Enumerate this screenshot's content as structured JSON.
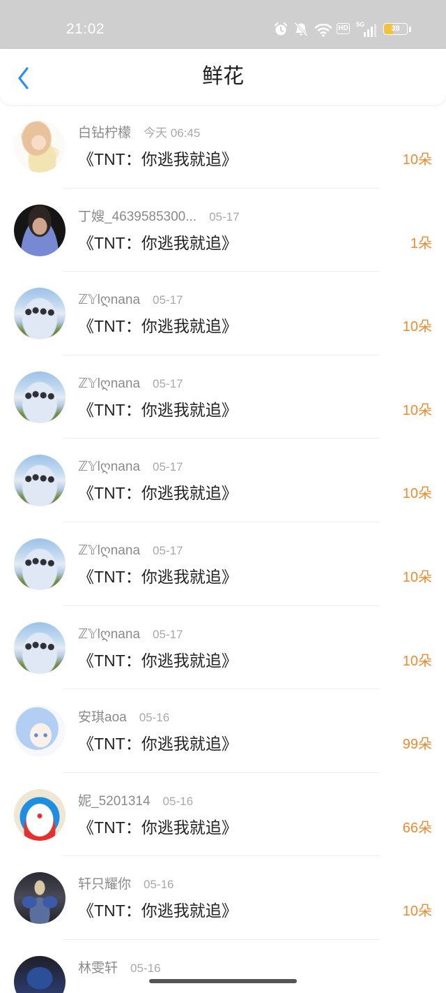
{
  "status_bar": {
    "time": "21:02",
    "hd_badge": "HD",
    "network_type": "5G",
    "battery_level": "39",
    "icons": [
      "alarm-icon",
      "bell-off-icon",
      "wifi-icon",
      "signal-icon",
      "battery-icon"
    ]
  },
  "header": {
    "title": "鲜花",
    "back_icon": "chevron-left-icon"
  },
  "colors": {
    "accent": "#2b8ff0",
    "flower_count": "#f08a2d",
    "status_bar_background": "#cfcfcf",
    "primary_text": "#222222",
    "secondary_text": "#8a8a8a"
  },
  "records": [
    {
      "name": "白钻柠檬",
      "time": "今天 06:45",
      "title": "《TNT：你逃我就追》",
      "count": "10朵"
    },
    {
      "name": "丁嫂_4639585300...",
      "time": "05-17",
      "title": "《TNT：你逃我就追》",
      "count": "1朵"
    },
    {
      "name": "ℤ𝕐lღnana",
      "time": "05-17",
      "title": "《TNT：你逃我就追》",
      "count": "10朵"
    },
    {
      "name": "ℤ𝕐lღnana",
      "time": "05-17",
      "title": "《TNT：你逃我就追》",
      "count": "10朵"
    },
    {
      "name": "ℤ𝕐lღnana",
      "time": "05-17",
      "title": "《TNT：你逃我就追》",
      "count": "10朵"
    },
    {
      "name": "ℤ𝕐lღnana",
      "time": "05-17",
      "title": "《TNT：你逃我就追》",
      "count": "10朵"
    },
    {
      "name": "ℤ𝕐lღnana",
      "time": "05-17",
      "title": "《TNT：你逃我就追》",
      "count": "10朵"
    },
    {
      "name": "安琪aoa",
      "time": "05-16",
      "title": "《TNT：你逃我就追》",
      "count": "99朵"
    },
    {
      "name": "妮_5201314",
      "time": "05-16",
      "title": "《TNT：你逃我就追》",
      "count": "66朵"
    },
    {
      "name": "轩只耀你",
      "time": "05-16",
      "title": "《TNT：你逃我就追》",
      "count": "10朵"
    },
    {
      "name": "林雯轩",
      "time": "05-16"
    }
  ]
}
